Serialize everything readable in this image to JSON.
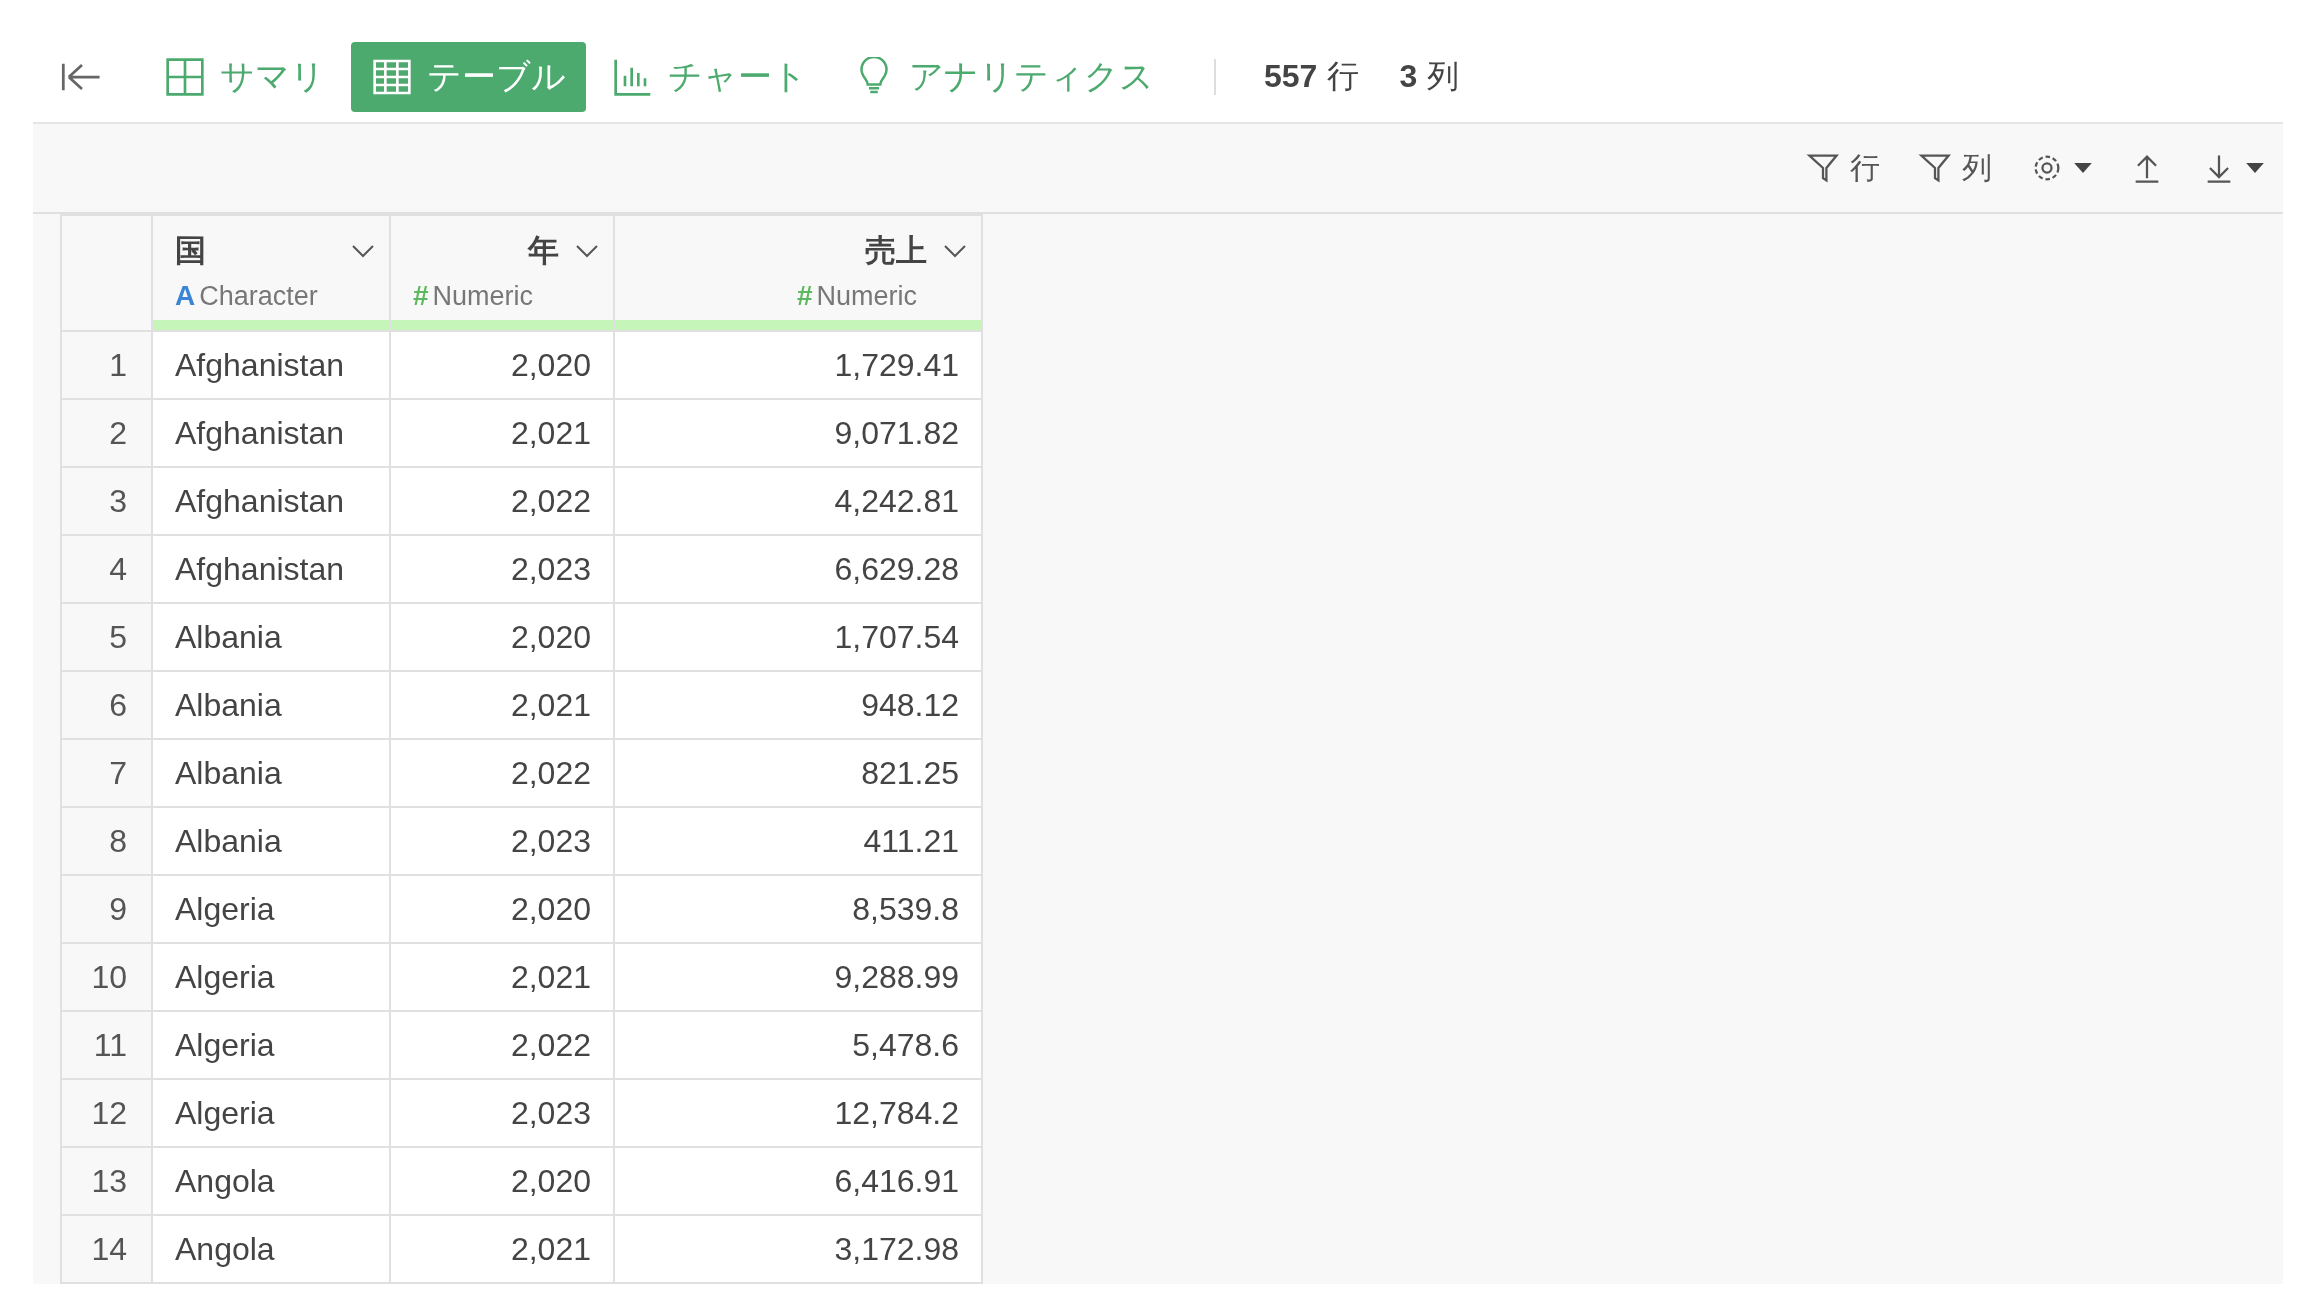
{
  "tabs": [
    {
      "label": "サマリ",
      "selected": false
    },
    {
      "label": "テーブル",
      "selected": true
    },
    {
      "label": "チャート",
      "selected": false
    },
    {
      "label": "アナリティクス",
      "selected": false
    }
  ],
  "counts": [
    {
      "value": "557",
      "unit": "行"
    },
    {
      "value": "3",
      "unit": "列"
    }
  ],
  "toolbar": [
    {
      "kind": "filter",
      "label": "行"
    },
    {
      "kind": "filter",
      "label": "列"
    },
    {
      "kind": "settings"
    },
    {
      "kind": "upload"
    },
    {
      "kind": "download"
    }
  ],
  "table": {
    "columns": [
      {
        "name": "国",
        "kind": "character",
        "type_icon": "A",
        "type_label": "Character"
      },
      {
        "name": "年",
        "kind": "numeric",
        "type_icon": "#",
        "type_label": "Numeric"
      },
      {
        "name": "売上",
        "kind": "numeric",
        "type_icon": "#",
        "type_label": "Numeric"
      }
    ],
    "rows": [
      {
        "index": "1",
        "cells": [
          "Afghanistan",
          "2,020",
          "1,729.41"
        ]
      },
      {
        "index": "2",
        "cells": [
          "Afghanistan",
          "2,021",
          "9,071.82"
        ]
      },
      {
        "index": "3",
        "cells": [
          "Afghanistan",
          "2,022",
          "4,242.81"
        ]
      },
      {
        "index": "4",
        "cells": [
          "Afghanistan",
          "2,023",
          "6,629.28"
        ]
      },
      {
        "index": "5",
        "cells": [
          "Albania",
          "2,020",
          "1,707.54"
        ]
      },
      {
        "index": "6",
        "cells": [
          "Albania",
          "2,021",
          "948.12"
        ]
      },
      {
        "index": "7",
        "cells": [
          "Albania",
          "2,022",
          "821.25"
        ]
      },
      {
        "index": "8",
        "cells": [
          "Albania",
          "2,023",
          "411.21"
        ]
      },
      {
        "index": "9",
        "cells": [
          "Algeria",
          "2,020",
          "8,539.8"
        ]
      },
      {
        "index": "10",
        "cells": [
          "Algeria",
          "2,021",
          "9,288.99"
        ]
      },
      {
        "index": "11",
        "cells": [
          "Algeria",
          "2,022",
          "5,478.6"
        ]
      },
      {
        "index": "12",
        "cells": [
          "Algeria",
          "2,023",
          "12,784.2"
        ]
      },
      {
        "index": "13",
        "cells": [
          "Angola",
          "2,020",
          "6,416.91"
        ]
      },
      {
        "index": "14",
        "cells": [
          "Angola",
          "2,021",
          "3,172.98"
        ]
      }
    ]
  }
}
